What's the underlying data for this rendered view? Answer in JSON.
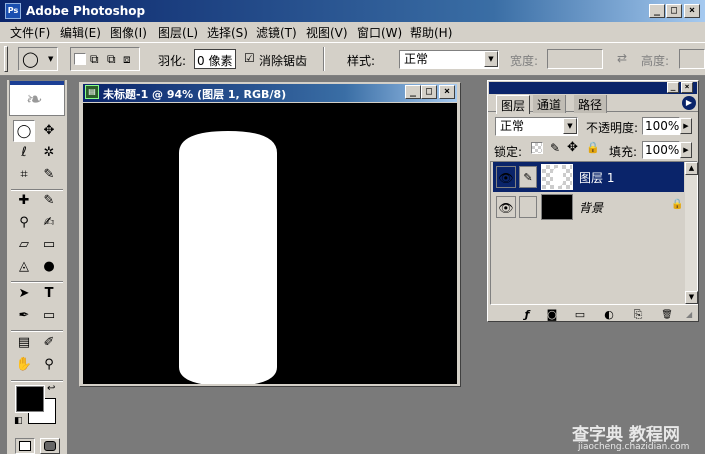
{
  "app": {
    "title": "Adobe Photoshop",
    "icon_text": "Ps",
    "window_buttons": [
      "_",
      "□",
      "×"
    ]
  },
  "menu": [
    "文件(F)",
    "编辑(E)",
    "图像(I)",
    "图层(L)",
    "选择(S)",
    "滤镜(T)",
    "视图(V)",
    "窗口(W)",
    "帮助(H)"
  ],
  "options": {
    "feather_label": "羽化:",
    "feather_value": "0 像素",
    "antialias_checkbox": "☑",
    "antialias_label": "消除锯齿",
    "style_label": "样式:",
    "style_value": "正常",
    "width_label": "宽度:",
    "height_label": "高度:",
    "swap_icon": "⇄"
  },
  "toolbox": {
    "tools": [
      {
        "name": "marquee-tool",
        "glyph": "◯"
      },
      {
        "name": "move-tool",
        "glyph": "✥"
      },
      {
        "name": "lasso-tool",
        "glyph": "ℓ"
      },
      {
        "name": "magic-wand-tool",
        "glyph": "✲"
      },
      {
        "name": "crop-tool",
        "glyph": "⌗"
      },
      {
        "name": "slice-tool",
        "glyph": "✎"
      },
      {
        "name": "healing-brush-tool",
        "glyph": "✚"
      },
      {
        "name": "brush-tool",
        "glyph": "✎"
      },
      {
        "name": "clone-stamp-tool",
        "glyph": "⚲"
      },
      {
        "name": "history-brush-tool",
        "glyph": "✍"
      },
      {
        "name": "eraser-tool",
        "glyph": "▱"
      },
      {
        "name": "gradient-tool",
        "glyph": "▭"
      },
      {
        "name": "blur-tool",
        "glyph": "◬"
      },
      {
        "name": "dodge-tool",
        "glyph": "●"
      },
      {
        "name": "path-selection-tool",
        "glyph": "➤"
      },
      {
        "name": "type-tool",
        "glyph": "T"
      },
      {
        "name": "pen-tool",
        "glyph": "✒"
      },
      {
        "name": "shape-tool",
        "glyph": "▭"
      },
      {
        "name": "notes-tool",
        "glyph": "▤"
      },
      {
        "name": "eyedropper-tool",
        "glyph": "✐"
      },
      {
        "name": "hand-tool",
        "glyph": "✋"
      },
      {
        "name": "zoom-tool",
        "glyph": "⚲"
      }
    ],
    "foreground_color": "#000000",
    "background_color": "#ffffff"
  },
  "document": {
    "title": "未标题-1 @ 94% (图层 1, RGB/8)",
    "canvas_color": "#000000",
    "shape_color": "#ffffff"
  },
  "layers_panel": {
    "tabs": [
      "图层",
      "通道",
      "路径"
    ],
    "blend_mode": "正常",
    "opacity_label": "不透明度:",
    "opacity_value": "100%",
    "lock_label": "锁定:",
    "fill_label": "填充:",
    "fill_value": "100%",
    "layers": [
      {
        "name": "图层 1",
        "selected": true
      },
      {
        "name": "背景",
        "selected": false,
        "locked": true
      }
    ],
    "footer_icons": [
      "ƒ",
      "◙",
      "▭",
      "◐",
      "⎘",
      "🗑"
    ]
  },
  "watermark": {
    "text": "查字典 教程网",
    "url": "jiaocheng.chazidian.com"
  }
}
